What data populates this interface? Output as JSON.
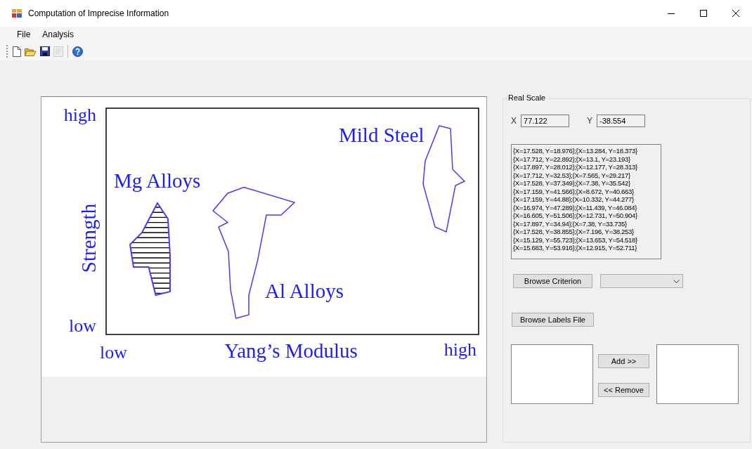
{
  "window": {
    "title": "Computation of Imprecise Information"
  },
  "menu": [
    "File",
    "Analysis"
  ],
  "toolbar": [
    [
      {
        "kind": "new",
        "disabled": false
      },
      {
        "kind": "open",
        "disabled": false
      },
      {
        "kind": "save",
        "disabled": false
      },
      {
        "kind": "export",
        "disabled": true
      }
    ],
    [
      {
        "kind": "help",
        "disabled": false
      }
    ]
  ],
  "diagram": {
    "y_axis": {
      "title": "Strength",
      "high": "high",
      "low": "low"
    },
    "x_axis": {
      "title": "Yang’s Modulus",
      "low": "low",
      "high": "high"
    },
    "regions": [
      {
        "label": "Mg Alloys",
        "hatched": true
      },
      {
        "label": "Al Alloys",
        "hatched": false
      },
      {
        "label": "Mild Steel",
        "hatched": false
      }
    ]
  },
  "real_scale": {
    "title": "Real Scale",
    "x_label": "X",
    "x_value": "77.122",
    "y_label": "Y",
    "y_value": "-38.554",
    "points": [
      "{X=17.528, Y=18.976};{X=13.284, Y=18.373}",
      "{X=17.712, Y=22.892};{X=13.1, Y=23.193}",
      "{X=17.897, Y=28.012};{X=12.177, Y=28.313}",
      "{X=17.712, Y=32.53};{X=7.565, Y=29.217}",
      "{X=17.528, Y=37.349};{X=7.38, Y=35.542}",
      "{X=17.159, Y=41.566};{X=8.672, Y=40.663}",
      "{X=17.159, Y=44.88};{X=10.332, Y=44.277}",
      "{X=16.974, Y=47.289};{X=11.439, Y=46.084}",
      "{X=16.605, Y=51.506};{X=12.731, Y=50.904}",
      "{X=17.897, Y=34.94};{X=7.38, Y=33.735}",
      "{X=17.528, Y=38.855};{X=7.196, Y=38.253}",
      "{X=15.129, Y=55.723};{X=13.653, Y=54.518}",
      "{X=15.683, Y=53.916};{X=12.915, Y=52.711}"
    ],
    "browse_criterion": "Browse Criterion",
    "browse_labels": "Browse Labels File",
    "add": "Add >>",
    "remove": "<< Remove"
  }
}
